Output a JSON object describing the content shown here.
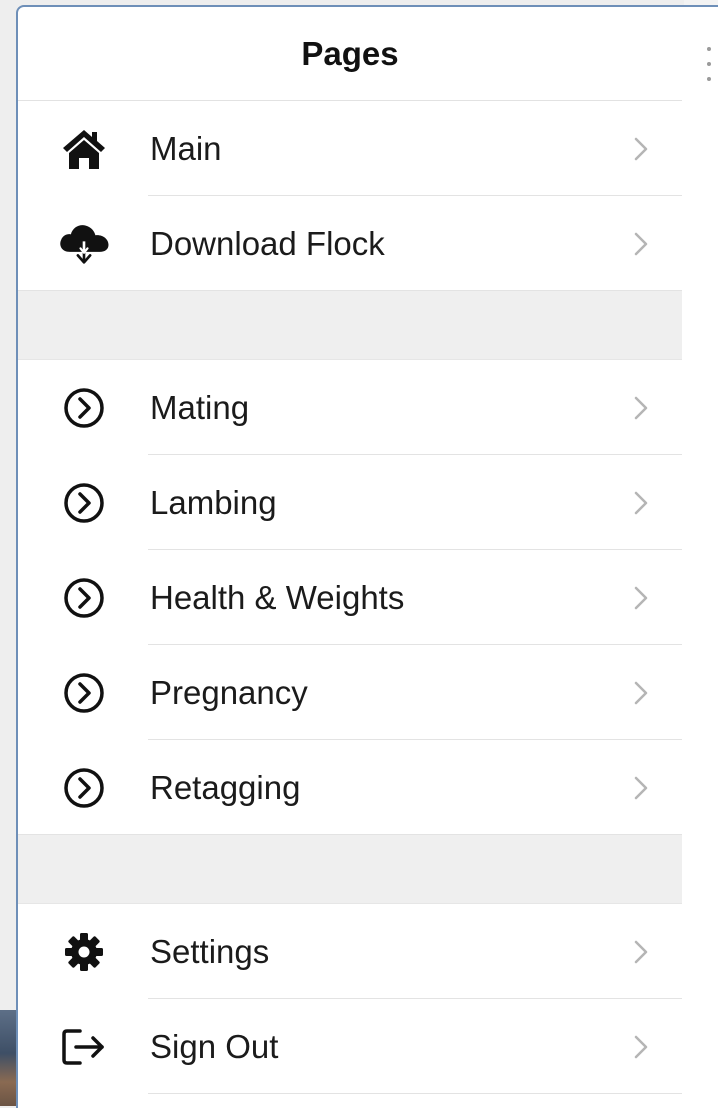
{
  "header": {
    "title": "Pages"
  },
  "groups": [
    {
      "items": [
        {
          "label": "Main",
          "icon": "home-icon"
        },
        {
          "label": "Download Flock",
          "icon": "cloud-download-icon"
        }
      ]
    },
    {
      "items": [
        {
          "label": "Mating",
          "icon": "chevron-circle-icon"
        },
        {
          "label": "Lambing",
          "icon": "chevron-circle-icon"
        },
        {
          "label": "Health & Weights",
          "icon": "chevron-circle-icon"
        },
        {
          "label": "Pregnancy",
          "icon": "chevron-circle-icon"
        },
        {
          "label": "Retagging",
          "icon": "chevron-circle-icon"
        }
      ]
    },
    {
      "items": [
        {
          "label": "Settings",
          "icon": "gear-icon"
        },
        {
          "label": "Sign Out",
          "icon": "sign-out-icon"
        }
      ]
    }
  ],
  "colors": {
    "panel_border": "#6e8fb8",
    "separator": "#e3e3e3",
    "section_gap": "#efefef"
  }
}
